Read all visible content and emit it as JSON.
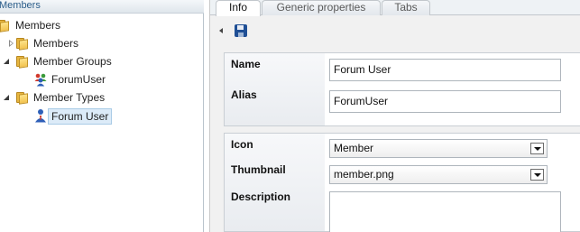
{
  "tree": {
    "header": "Members",
    "nodes": [
      {
        "label": "Members",
        "level": 0,
        "icon": "folder-icon",
        "expander": "none"
      },
      {
        "label": "Members",
        "level": 1,
        "icon": "folder-icon",
        "expander": "collapsed"
      },
      {
        "label": "Member Groups",
        "level": 1,
        "icon": "folder-icon",
        "expander": "expanded"
      },
      {
        "label": "ForumUser",
        "level": 2,
        "icon": "member-group-icon",
        "expander": "none"
      },
      {
        "label": "Member Types",
        "level": 1,
        "icon": "folder-icon",
        "expander": "expanded"
      },
      {
        "label": "Forum User",
        "level": 2,
        "icon": "member-icon",
        "expander": "none",
        "selected": true
      }
    ]
  },
  "tabs": [
    {
      "label": "Info",
      "active": true
    },
    {
      "label": "Generic properties",
      "active": false
    },
    {
      "label": "Tabs",
      "active": false
    }
  ],
  "toolbar": {
    "back_icon": "triangle-left-icon",
    "save_icon": "save-icon"
  },
  "form": {
    "name_label": "Name",
    "name_value": "Forum User",
    "alias_label": "Alias",
    "alias_value": "ForumUser",
    "icon_label": "Icon",
    "icon_value": "Member",
    "thumbnail_label": "Thumbnail",
    "thumbnail_value": "member.png",
    "description_label": "Description",
    "description_value": ""
  },
  "colors": {
    "selected_node_bg": "#dcebf8",
    "save_icon": "#1f4f95",
    "folder": "#f2c24e"
  }
}
